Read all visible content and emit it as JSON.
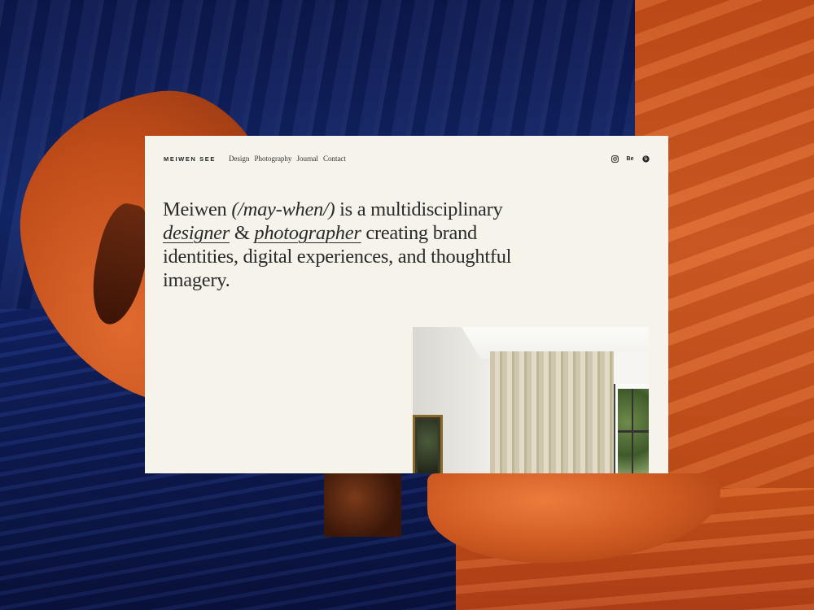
{
  "site": {
    "brand": "MEIWEN SEE",
    "nav": [
      "Design",
      "Photography",
      "Journal",
      "Contact"
    ],
    "social": [
      {
        "icon": "instagram-icon",
        "label": ""
      },
      {
        "icon": "behance-icon",
        "label": "Be"
      },
      {
        "icon": "pinterest-icon",
        "label": ""
      }
    ]
  },
  "intro": {
    "name": "Meiwen",
    "pronunciation": "(/may-when/)",
    "text_1": "is a multidisciplinary",
    "role_1": "designer",
    "amp": "&",
    "role_2": "photographer",
    "text_2": "creating brand identities, digital experiences, and thoughtful imagery."
  },
  "colors": {
    "card_bg": "#f6f3ea",
    "text": "#2a2a2a",
    "velvet": "#13286e",
    "orange": "#d9632a"
  }
}
